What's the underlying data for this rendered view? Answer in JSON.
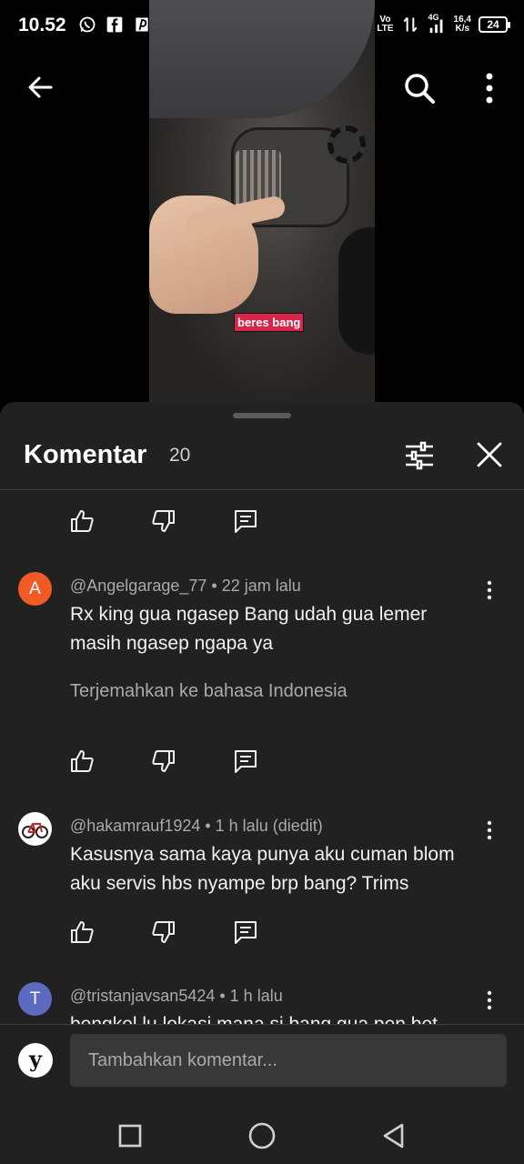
{
  "status_bar": {
    "time": "10.52",
    "left_icons": [
      "whatsapp-icon",
      "facebook-icon",
      "pinterest-icon",
      "shield-icon"
    ],
    "net_speed_value": "16,4",
    "net_speed_unit": "K/s",
    "battery": "24",
    "vo_top": "Vo",
    "vo_bottom": "LTE",
    "network_label": "4G"
  },
  "video": {
    "caption": "beres bang"
  },
  "comments_panel": {
    "title": "Komentar",
    "count": "20",
    "items": [
      {
        "avatar_letter": "A",
        "avatar_color": "#f05a24",
        "meta": "@Angelgarage_77 • 22 jam lalu",
        "text": "Rx king gua ngasep Bang udah gua lemer masih ngasep ngapa ya",
        "translate": "Terjemahkan ke bahasa Indonesia"
      },
      {
        "avatar_letter": "",
        "avatar_color": "#ffffff",
        "meta": "@hakamrauf1924 • 1 h lalu (diedit)",
        "text": "Kasusnya sama kaya punya aku cuman blom aku servis hbs nyampe brp bang? Trims"
      },
      {
        "avatar_letter": "T",
        "avatar_color": "#5c6bc0",
        "meta": "@tristanjavsan5424 • 1 h lalu",
        "text": "bengkel lu lokasi mana si bang gua pen bet"
      }
    ]
  },
  "add_comment": {
    "avatar_letter": "y",
    "placeholder": "Tambahkan komentar..."
  },
  "colors": {
    "sheet_bg": "#212121",
    "caption_bg": "#d9254a"
  }
}
